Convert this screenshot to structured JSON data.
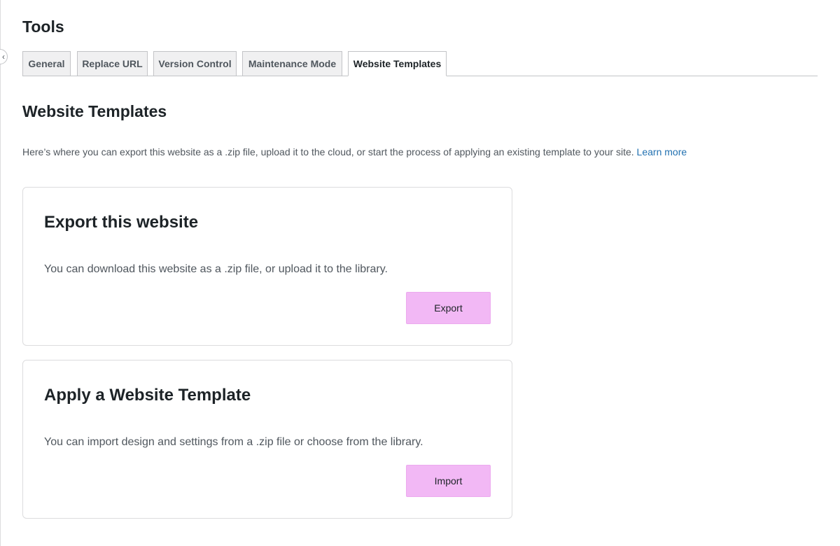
{
  "header": {
    "title": "Tools"
  },
  "tabs": [
    {
      "label": "General",
      "active": false
    },
    {
      "label": "Replace URL",
      "active": false
    },
    {
      "label": "Version Control",
      "active": false
    },
    {
      "label": "Maintenance Mode",
      "active": false
    },
    {
      "label": "Website Templates",
      "active": true
    }
  ],
  "sidebar_toggle": {
    "icon": "chevron-left-icon",
    "glyph": "‹"
  },
  "section": {
    "title": "Website Templates",
    "description": "Here’s where you can export this website as a .zip file, upload it to the cloud, or start the process of applying an existing template to your site.",
    "learn_more": "Learn more"
  },
  "export_card": {
    "title": "Export this website",
    "text": "You can download this website as a .zip file, or upload it to the library.",
    "button_label": "Export"
  },
  "import_card": {
    "title": "Apply a Website Template",
    "text": "You can import design and settings from a .zip file or choose from the library.",
    "button_label": "Import"
  },
  "colors": {
    "accent_button": "#f2b8f5",
    "link": "#2271b1"
  }
}
